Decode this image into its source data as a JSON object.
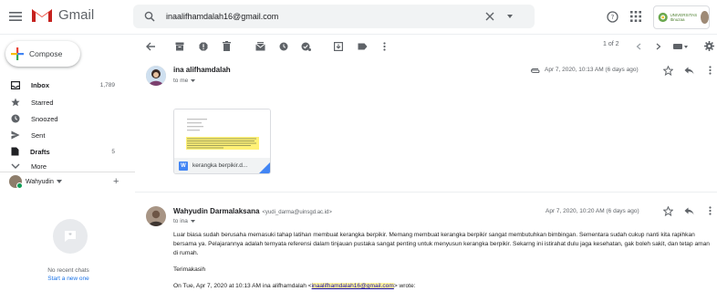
{
  "header": {
    "app_name": "Gmail",
    "search_value": "inaalifhamdalah16@gmail.com",
    "brand_text_1": "UNIVERSITAS",
    "brand_text_2": "Ibnuzaa"
  },
  "sidebar": {
    "compose": "Compose",
    "items": [
      {
        "label": "Inbox",
        "count": "1,789"
      },
      {
        "label": "Starred",
        "count": ""
      },
      {
        "label": "Snoozed",
        "count": ""
      },
      {
        "label": "Sent",
        "count": ""
      },
      {
        "label": "Drafts",
        "count": "5"
      },
      {
        "label": "More",
        "count": ""
      }
    ],
    "account_name": "Wahyudin",
    "chat_empty": "No recent chats",
    "chat_link": "Start a new one"
  },
  "toolbar": {
    "pager": "1 of 2"
  },
  "thread": {
    "messages": [
      {
        "sender": "ina alifhamdalah",
        "email": "",
        "to": "to me",
        "date": "Apr 7, 2020, 10:13 AM (6 days ago)",
        "attachment": "kerangka berpikir.d..."
      },
      {
        "sender": "Wahyudin Darmalaksana",
        "email": "<yudi_darma@uinsgd.ac.id>",
        "to": "to ina",
        "date": "Apr 7, 2020, 10:20 AM (6 days ago)",
        "body_1": "Luar biasa sudah berusaha memasuki tahap latihan membuat kerangka berpikir. Memang membuat kerangka berpikir sangat membutuhkan bimbingan. Sementara sudah cukup nanti kita rapihkan bersama ya. Pelajarannya adalah ternyata referensi dalam tinjauan pustaka sangat penting untuk menyusun kerangka berpikir. Sekarng ini istirahat dulu jaga kesehatan, gak boleh sakit, dan tetap aman di rumah.",
        "body_2": "Terimakasih",
        "quote_prefix": "On Tue, Apr 7, 2020 at 10:13 AM ina alifhamdalah <",
        "quote_link": "inaalifhamdalah16@gmail.com",
        "quote_suffix": "> wrote:"
      }
    ]
  },
  "colors": {
    "accent": "#1a73e8",
    "gmail_red": "#ea4335",
    "highlight": "#fff59d"
  }
}
